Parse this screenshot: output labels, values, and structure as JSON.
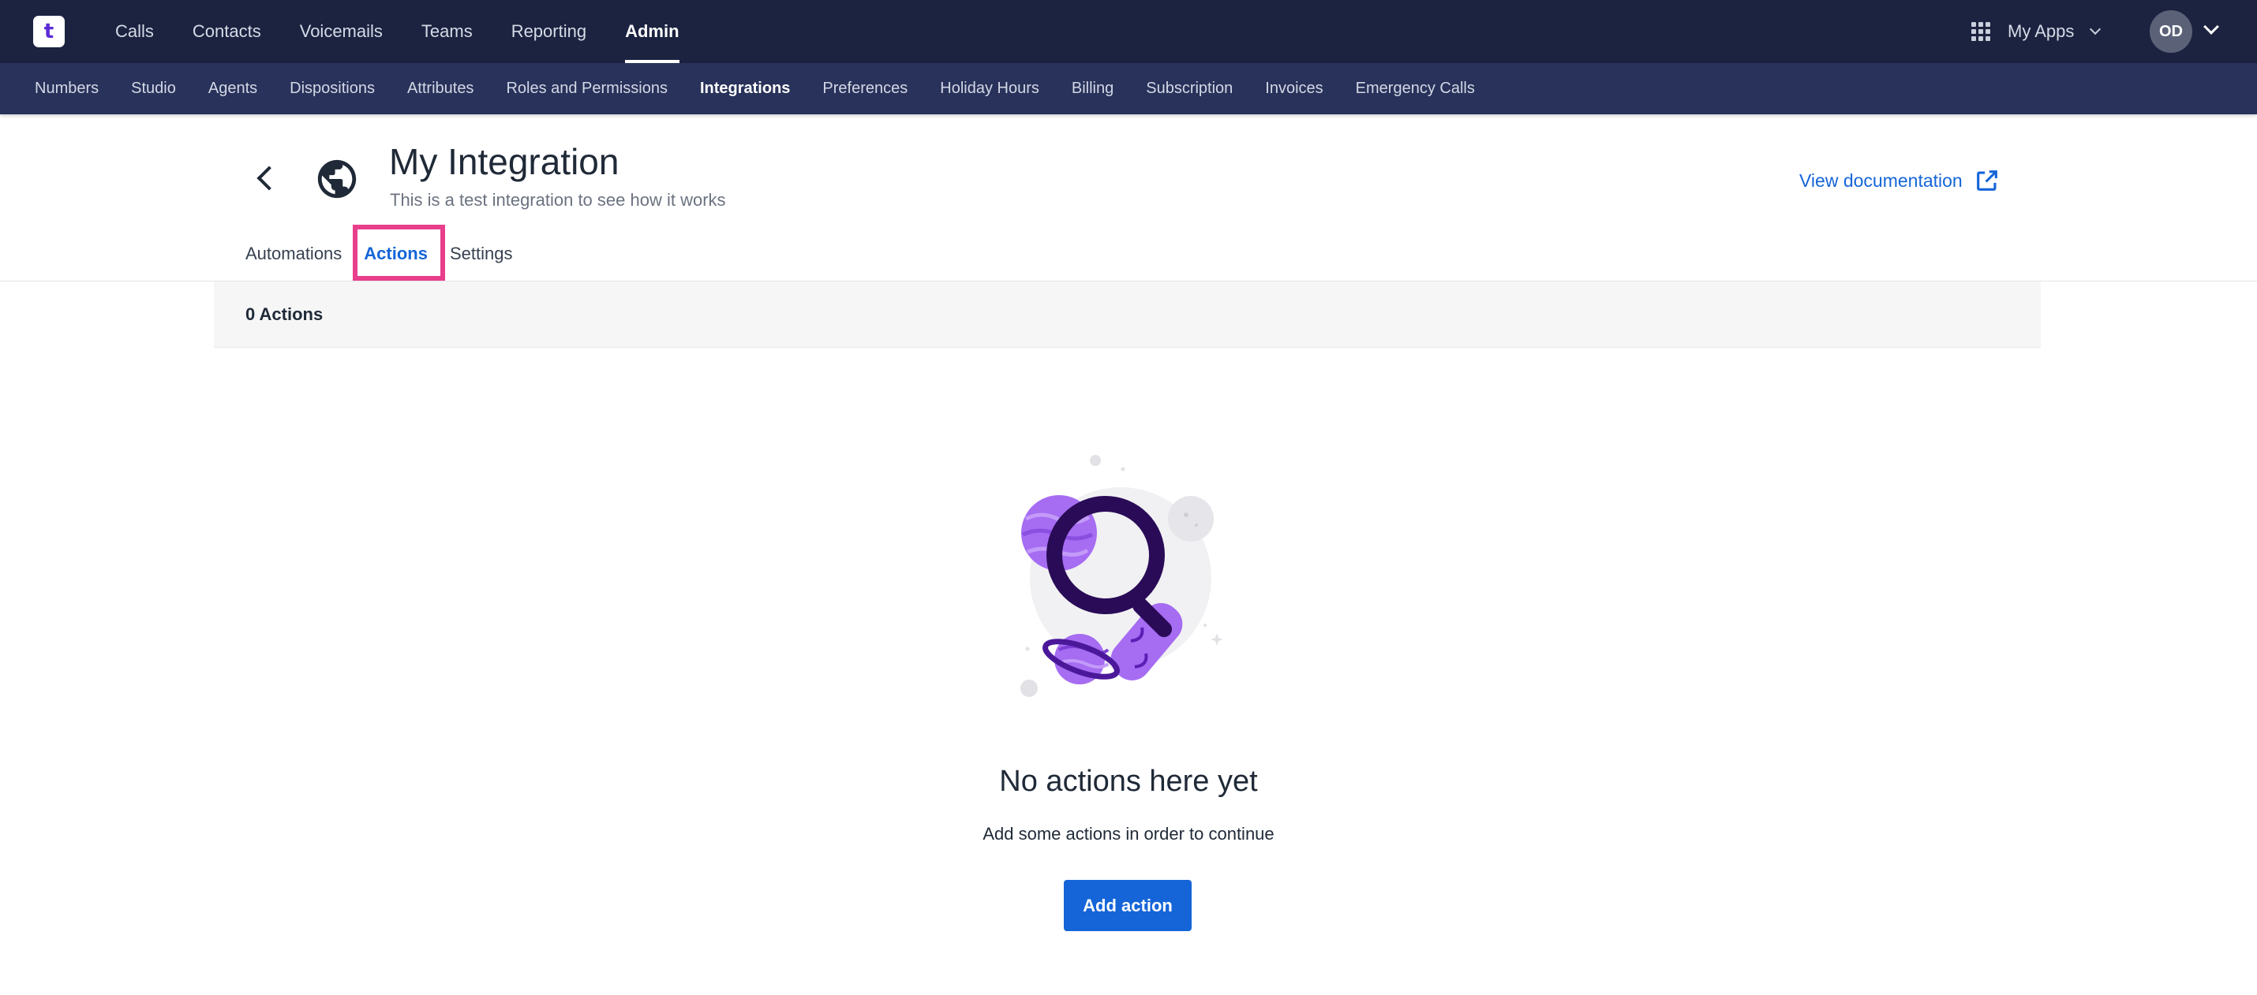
{
  "app": {
    "logo_text": "t"
  },
  "topnav": {
    "items": [
      {
        "label": "Calls"
      },
      {
        "label": "Contacts"
      },
      {
        "label": "Voicemails"
      },
      {
        "label": "Teams"
      },
      {
        "label": "Reporting"
      },
      {
        "label": "Admin",
        "active": true
      }
    ],
    "my_apps_label": "My Apps",
    "avatar_initials": "OD"
  },
  "subnav": {
    "items": [
      {
        "label": "Numbers"
      },
      {
        "label": "Studio"
      },
      {
        "label": "Agents"
      },
      {
        "label": "Dispositions"
      },
      {
        "label": "Attributes"
      },
      {
        "label": "Roles and Permissions"
      },
      {
        "label": "Integrations",
        "active": true
      },
      {
        "label": "Preferences"
      },
      {
        "label": "Holiday Hours"
      },
      {
        "label": "Billing"
      },
      {
        "label": "Subscription"
      },
      {
        "label": "Invoices"
      },
      {
        "label": "Emergency Calls"
      }
    ]
  },
  "header": {
    "title": "My Integration",
    "subtitle": "This is a test integration to see how it works",
    "view_doc_label": "View documentation"
  },
  "tabs": {
    "items": [
      {
        "label": "Automations"
      },
      {
        "label": "Actions",
        "active": true
      },
      {
        "label": "Settings"
      }
    ]
  },
  "count_label": "0 Actions",
  "empty_state": {
    "title": "No actions here yet",
    "text": "Add some actions in order to continue",
    "button_label": "Add action"
  },
  "colors": {
    "topbar": "#1b2340",
    "subbar": "#28325a",
    "accent": "#1565d8",
    "highlight": "#e83e8c",
    "purple": "#9b5cf0"
  }
}
